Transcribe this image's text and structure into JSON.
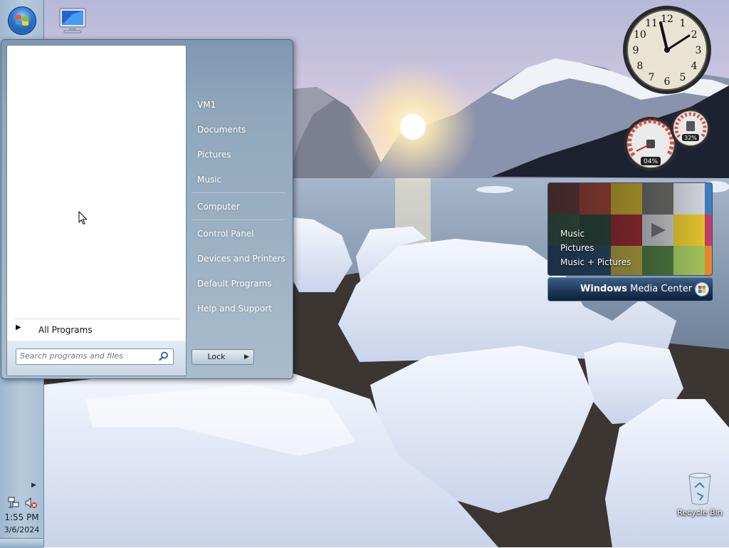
{
  "taskbar": {
    "clock_time": "1:55 PM",
    "clock_date": "3/6/2024"
  },
  "desktop": {
    "recycle_bin_label": "Recycle Bin"
  },
  "start_menu": {
    "all_programs_label": "All Programs",
    "search_placeholder": "Search programs and files",
    "places": [
      "VM1",
      "Documents",
      "Pictures",
      "Music",
      "Computer",
      "Control Panel",
      "Devices and Printers",
      "Default Programs",
      "Help and Support"
    ],
    "lock_label": "Lock"
  },
  "gadgets": {
    "clock": {
      "numerals": [
        "12",
        "1",
        "2",
        "3",
        "4",
        "5",
        "6",
        "7",
        "8",
        "9",
        "10",
        "11"
      ]
    },
    "cpu_meter": {
      "cpu_label": "04%",
      "memory_label": "32%"
    },
    "media_center": {
      "links": [
        "Music",
        "Pictures",
        "Music + Pictures"
      ],
      "title_bold": "Windows",
      "title_light": " Media Center"
    }
  },
  "colors": {
    "accent": "#2d74c7",
    "start_menu_bg": "#8fa6bb",
    "taskbar_bg": "#b7cadc"
  }
}
